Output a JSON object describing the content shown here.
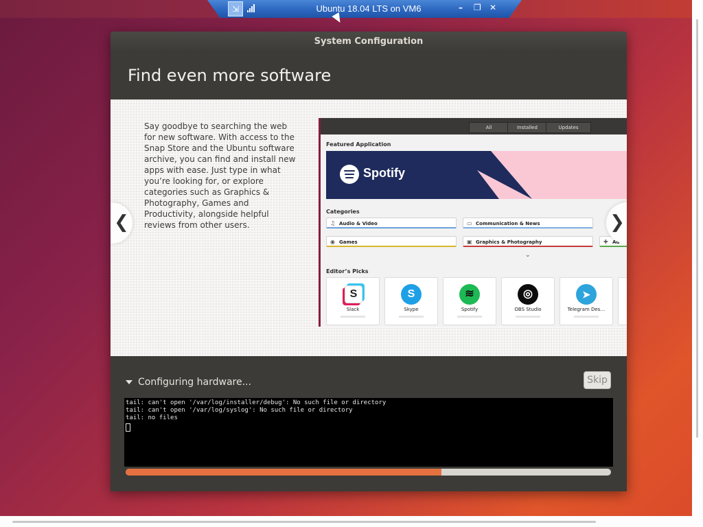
{
  "remote_session": {
    "title": "Ubuntu 18.04 LTS on VM6",
    "pin_glyph": "⇲",
    "minimize_glyph": "–",
    "restore_glyph": "❐",
    "close_glyph": "✕"
  },
  "window": {
    "title": "System Configuration",
    "heading": "Find even more software"
  },
  "slide": {
    "description": "Say goodbye to searching the web for new software. With access to the Snap Store and the Ubuntu software archive, you can find and install new apps with ease. Just type in what you’re looking for, or explore categories such as Graphics & Photography, Games and Productivity, alongside helpful reviews from other users.",
    "prev_glyph": "❮",
    "next_glyph": "❯",
    "screenshot": {
      "tabs": [
        "All",
        "Installed",
        "Updates"
      ],
      "featured_label": "Featured Application",
      "featured_app": "Spotify",
      "categories_label": "Categories",
      "categories": [
        {
          "label": "Audio & Video",
          "icon": "music-note-icon",
          "glyph": "♫",
          "accent": "#6aa0d8"
        },
        {
          "label": "Communication & News",
          "icon": "chat-icon",
          "glyph": "▭",
          "accent": "#7aaee0"
        },
        {
          "label": "Games",
          "icon": "gamepad-icon",
          "glyph": "◉",
          "accent": "#d8b62a"
        },
        {
          "label": "Graphics & Photography",
          "icon": "camera-icon",
          "glyph": "▣",
          "accent": "#c43a3a"
        },
        {
          "label": "Ad",
          "icon": "puzzle-icon",
          "glyph": "✚",
          "accent": "#5aa84a"
        }
      ],
      "expand_glyph": "⌄",
      "picks_label": "Editor’s Picks",
      "picks": [
        {
          "name": "Slack",
          "icon": "slack-icon",
          "glyph": "S",
          "color": "#ffffff"
        },
        {
          "name": "Skype",
          "icon": "skype-icon",
          "glyph": "S",
          "color": "#1ea0e6"
        },
        {
          "name": "Spotify",
          "icon": "spotify-icon",
          "glyph": "≋",
          "color": "#1db954"
        },
        {
          "name": "OBS Studio",
          "icon": "obs-icon",
          "glyph": "◎",
          "color": "#0c0c0c"
        },
        {
          "name": "Telegram Des…",
          "icon": "telegram-icon",
          "glyph": "➤",
          "color": "#2ea4dc"
        }
      ]
    }
  },
  "status": {
    "label": "Configuring hardware...",
    "skip_label": "Skip",
    "terminal_lines": [
      "tail: can't open '/var/log/installer/debug': No such file or directory",
      "tail: can't open '/var/log/syslog': No such file or directory",
      "tail: no files"
    ],
    "progress_fraction": 0.65,
    "progress_color": "#e4713f"
  }
}
